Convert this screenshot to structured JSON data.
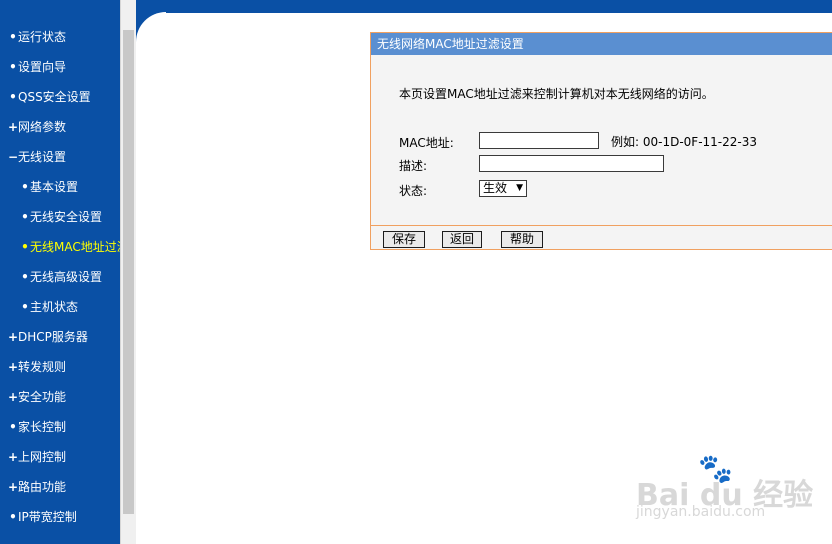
{
  "sidebar": {
    "items": [
      {
        "marker": "•",
        "label": "运行状态"
      },
      {
        "marker": "•",
        "label": "设置向导"
      },
      {
        "marker": "•",
        "label": "QSS安全设置"
      },
      {
        "marker": "+",
        "label": "网络参数"
      },
      {
        "marker": "−",
        "label": "无线设置"
      },
      {
        "marker": "•",
        "label": "基本设置"
      },
      {
        "marker": "•",
        "label": "无线安全设置"
      },
      {
        "marker": "•",
        "label": "无线MAC地址过滤"
      },
      {
        "marker": "•",
        "label": "无线高级设置"
      },
      {
        "marker": "•",
        "label": "主机状态"
      },
      {
        "marker": "+",
        "label": "DHCP服务器"
      },
      {
        "marker": "+",
        "label": "转发规则"
      },
      {
        "marker": "+",
        "label": "安全功能"
      },
      {
        "marker": "•",
        "label": "家长控制"
      },
      {
        "marker": "+",
        "label": "上网控制"
      },
      {
        "marker": "+",
        "label": "路由功能"
      },
      {
        "marker": "•",
        "label": "IP带宽控制"
      }
    ]
  },
  "panel": {
    "title": "无线网络MAC地址过滤设置",
    "description": "本页设置MAC地址过滤来控制计算机对本无线网络的访问。",
    "mac_label": "MAC地址:",
    "mac_value": "",
    "example": "例如: 00-1D-0F-11-22-33",
    "desc_label": "描述:",
    "desc_value": "",
    "status_label": "状态:",
    "status_value": "生效",
    "buttons": {
      "save": "保存",
      "back": "返回",
      "help": "帮助"
    }
  },
  "watermark": {
    "main": "Bai du 经验",
    "sub": "jingyan.baidu.com"
  },
  "colors": {
    "sidebar_bg": "#0a50a5",
    "panel_header": "#5a8fd1",
    "panel_border": "#f0a060",
    "active_item": "#ffff00"
  }
}
